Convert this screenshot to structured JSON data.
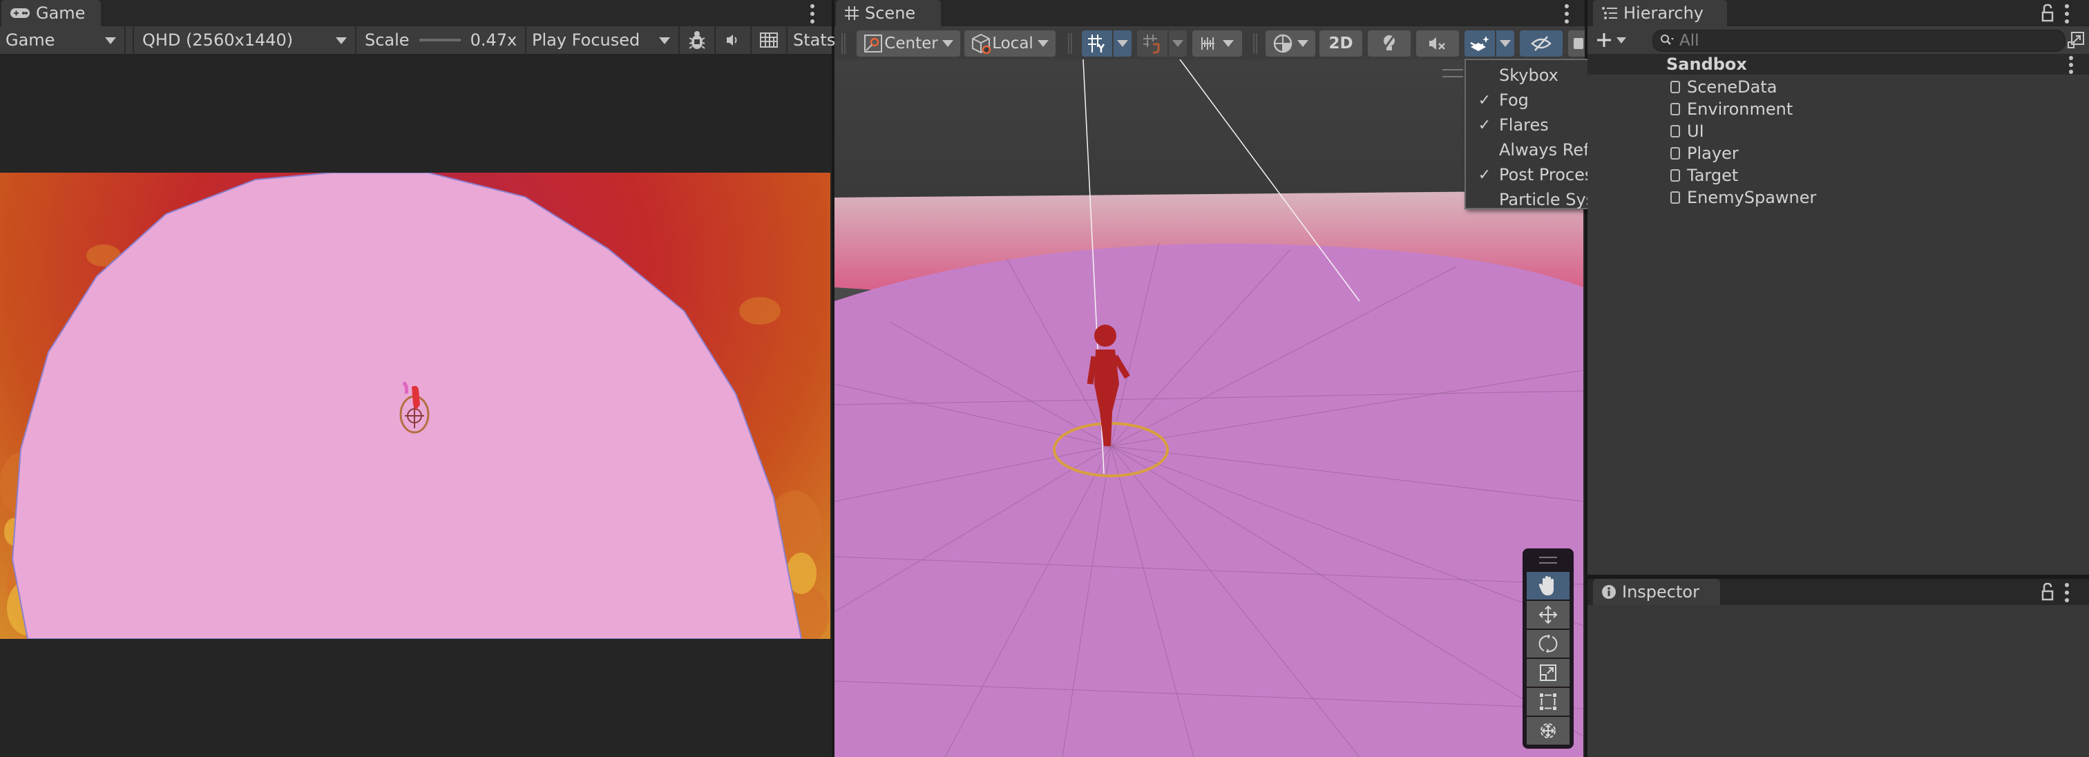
{
  "game": {
    "tab_title": "Game",
    "tab_icon": "gamepad-icon",
    "display_select": "Game",
    "resolution_select": "QHD (2560x1440)",
    "scale_label": "Scale",
    "scale_value": "0.47x",
    "play_mode_select": "Play Focused",
    "stats_label": "Stats",
    "icons": [
      "bug-icon",
      "speaker-icon",
      "grid-gizmos-icon"
    ]
  },
  "scene": {
    "tab_title": "Scene",
    "tab_icon": "hash-grid-icon",
    "pivot_label": "Center",
    "space_label": "Local",
    "mode_2d_label": "2D",
    "effects_menu": {
      "items": [
        {
          "label": "Skybox",
          "checked": false
        },
        {
          "label": "Fog",
          "checked": true
        },
        {
          "label": "Flares",
          "checked": true
        },
        {
          "label": "Always Refresh",
          "checked": false
        },
        {
          "label": "Post Processing",
          "checked": true
        },
        {
          "label": "Particle Systems",
          "checked": false
        }
      ],
      "check_glyph": "✓"
    },
    "tools": [
      "hand-tool",
      "move-tool",
      "rotate-tool",
      "scale-tool",
      "rect-tool",
      "transform-tool"
    ],
    "active_tool": "hand-tool"
  },
  "hierarchy": {
    "tab_title": "Hierarchy",
    "search_placeholder": "All",
    "scene_name": "Sandbox",
    "items": [
      "SceneData",
      "Environment",
      "UI",
      "Player",
      "Target",
      "EnemySpawner"
    ]
  },
  "inspector": {
    "tab_title": "Inspector"
  },
  "colors": {
    "accent_active": "#46607c",
    "panel_bg": "#383838",
    "toolbar_bg": "#3c3c3c",
    "floor_pink": "#e9a6d3",
    "scene_floor": "#c77fc6"
  }
}
